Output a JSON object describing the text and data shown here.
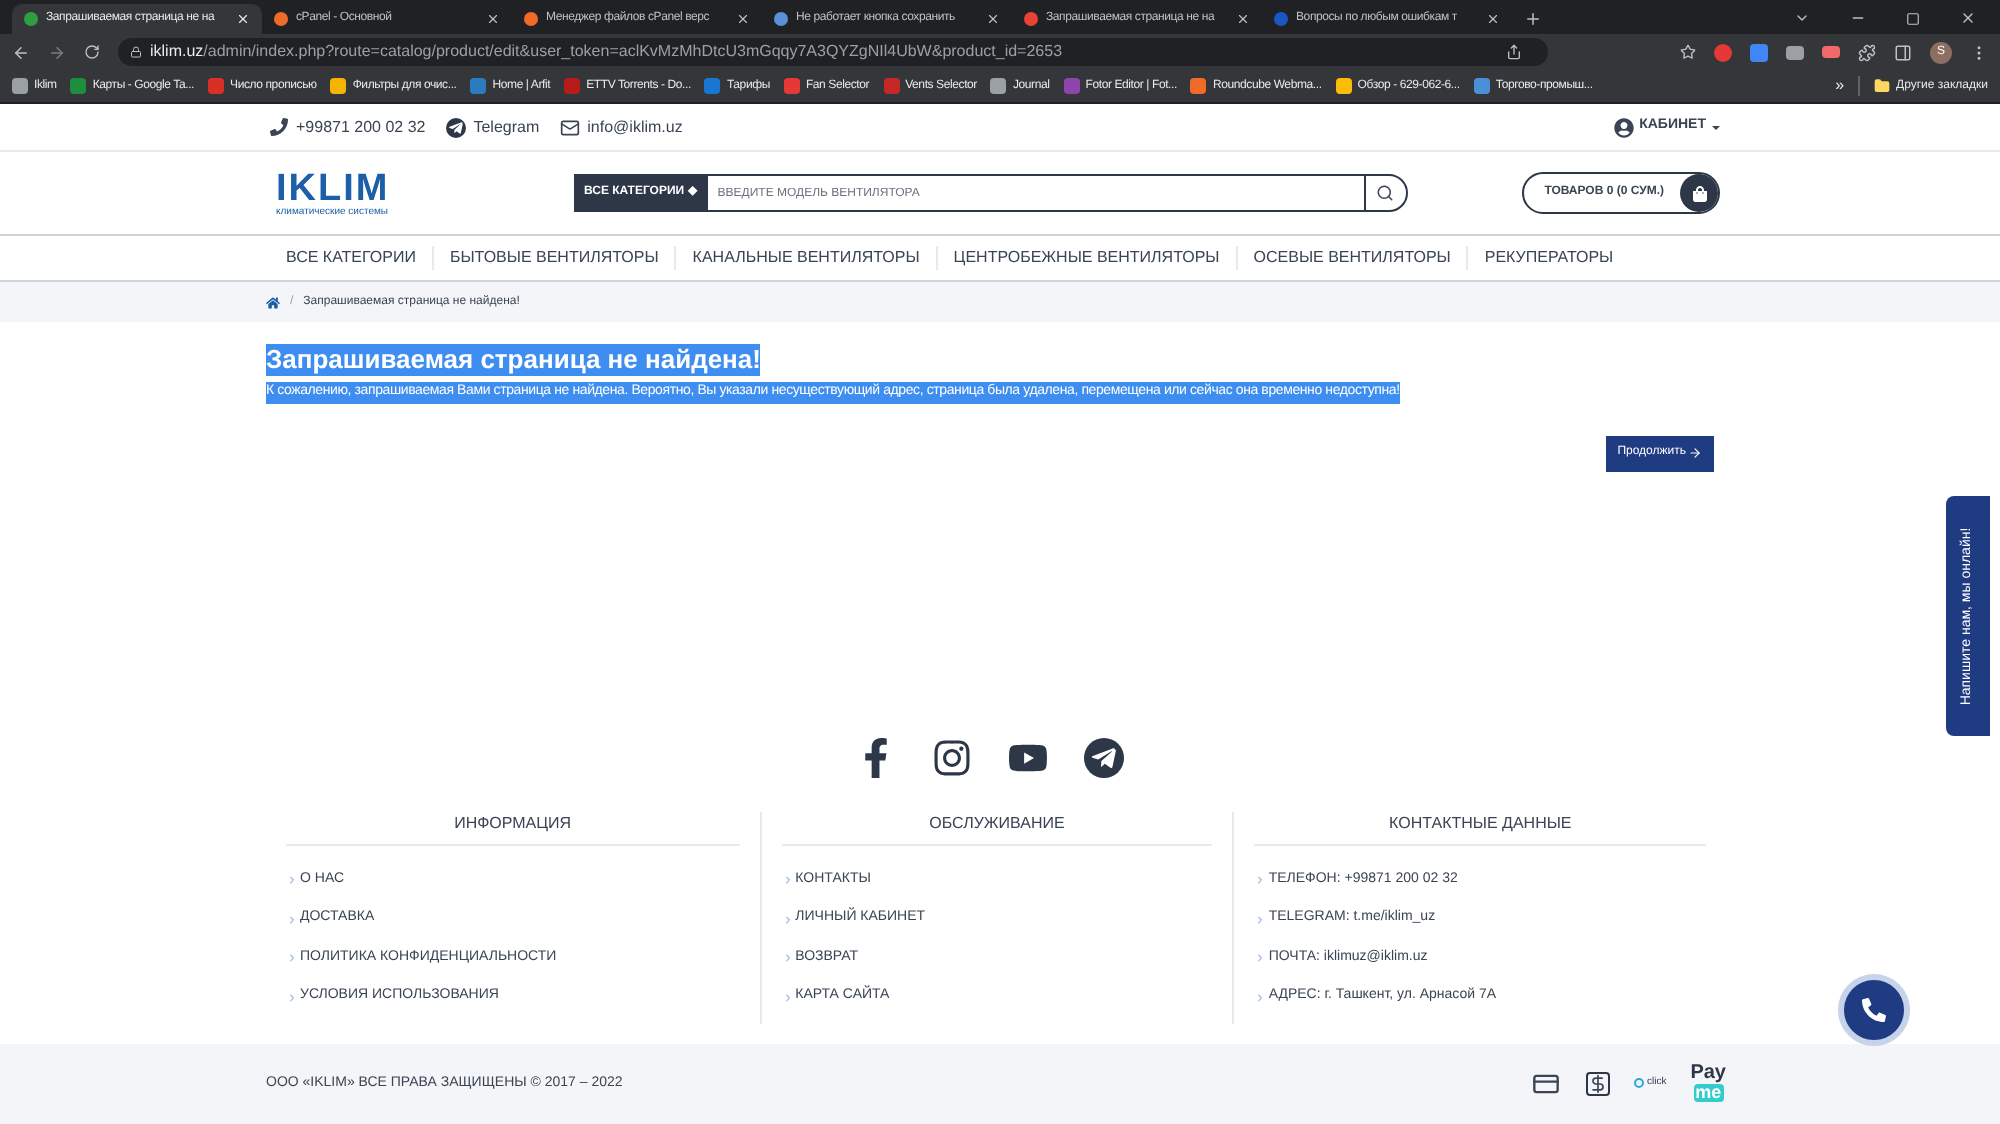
{
  "browser": {
    "tabs": [
      {
        "title": "Запрашиваемая страница не на",
        "selected": true,
        "color": "#2e9e44"
      },
      {
        "title": "cPanel - Основной",
        "selected": false,
        "color": "#f06a28"
      },
      {
        "title": "Менеджер файлов cPanel верс",
        "selected": false,
        "color": "#f06a28"
      },
      {
        "title": "Не работает кнопка сохранить",
        "selected": false,
        "color": "#5b8fd6"
      },
      {
        "title": "Запрашиваемая страница не на",
        "selected": false,
        "color": "#ea4335"
      },
      {
        "title": "Вопросы по любым ошибкам т",
        "selected": false,
        "color": "#1a56c4"
      }
    ],
    "url_host": "iklim.uz",
    "url_path": "/admin/index.php?route=catalog/product/edit&user_token=aclKvMzMhDtcU3mGqqy7A3QYZgNIl4UbW&product_id=2653",
    "profile": "S",
    "bookmarks": [
      {
        "label": "Iklim",
        "color": "#9aa0a6"
      },
      {
        "label": "Карты - Google Ta...",
        "color": "#1e8e3e"
      },
      {
        "label": "Число прописью",
        "color": "#d93025"
      },
      {
        "label": "Фильтры для очис...",
        "color": "#f4b400"
      },
      {
        "label": "Home | Arfit",
        "color": "#2a7bbf"
      },
      {
        "label": "ETTV Torrents - Do...",
        "color": "#b71c1c"
      },
      {
        "label": "Тарифы",
        "color": "#1976d2"
      },
      {
        "label": "Fan Selector",
        "color": "#e53935"
      },
      {
        "label": "Vents Selector",
        "color": "#c62828"
      },
      {
        "label": "Journal",
        "color": "#9aa0a6"
      },
      {
        "label": "Fotor Editor | Fot...",
        "color": "#8e44ad"
      },
      {
        "label": "Roundcube Webma...",
        "color": "#f06a28"
      },
      {
        "label": "Обзор - 629-062-6...",
        "color": "#fbbc04"
      },
      {
        "label": "Торгово-промыш...",
        "color": "#4a90d9"
      }
    ],
    "more": "»",
    "other_bookmarks": "Другие закладки"
  },
  "topbar": {
    "phone": "+99871 200 02 32",
    "telegram": "Telegram",
    "email": "info@iklim.uz",
    "account": "КАБИНЕТ"
  },
  "header": {
    "logo": "IKLIM",
    "logo_sub": "климатические системы",
    "category_button": "ВСЕ КАТЕГОРИИ",
    "category_caret": "◆",
    "search_placeholder": "ВВЕДИТЕ МОДЕЛЬ ВЕНТИЛЯТОРА",
    "cart": "ТОВАРОВ 0 (0 СУМ.)"
  },
  "nav": [
    "ВСЕ КАТЕГОРИИ",
    "БЫТОВЫЕ ВЕНТИЛЯТОРЫ",
    "КАНАЛЬНЫЕ ВЕНТИЛЯТОРЫ",
    "ЦЕНТРОБЕЖНЫЕ ВЕНТИЛЯТОРЫ",
    "ОСЕВЫЕ ВЕНТИЛЯТОРЫ",
    "РЕКУПЕРАТОРЫ"
  ],
  "breadcrumb_separator": "/",
  "breadcrumb": "Запрашиваемая страница не найдена!",
  "content": {
    "title": "Запрашиваемая страница не найдена!",
    "text": "К сожалению, запрашиваемая Вами страница не найдена. Вероятно, Вы указали несуществующий адрес, страница была удалена, перемещена или сейчас она временно недоступна!",
    "button": "Продолжить"
  },
  "footer": {
    "columns": [
      {
        "title": "ИНФОРМАЦИЯ",
        "links": [
          "О НАС",
          "ДОСТАВКА",
          "ПОЛИТИКА КОНФИДЕНЦИАЛЬНОСТИ",
          "УСЛОВИЯ ИСПОЛЬЗОВАНИЯ"
        ]
      },
      {
        "title": "ОБСЛУЖИВАНИЕ",
        "links": [
          "КОНТАКТЫ",
          "ЛИЧНЫЙ КАБИНЕТ",
          "ВОЗВРАТ",
          "КАРТА САЙТА"
        ]
      },
      {
        "title": "КОНТАКТНЫЕ ДАННЫЕ",
        "links": [
          "ТЕЛЕФОН: +99871 200 02 32",
          "TELEGRAM: t.me/iklim_uz",
          "ПОЧТА: iklimuz@iklim.uz",
          "АДРЕС: г. Ташкент, ул. Арнасой 7А"
        ]
      }
    ],
    "copyright": "ООО «IKLIM» ВСЕ ПРАВА ЗАЩИЩЕНЫ © 2017 – 2022",
    "click": "click",
    "payme_top": "Pay",
    "payme_bottom": "me"
  },
  "chat": "Напишите нам, мы онлайн!"
}
